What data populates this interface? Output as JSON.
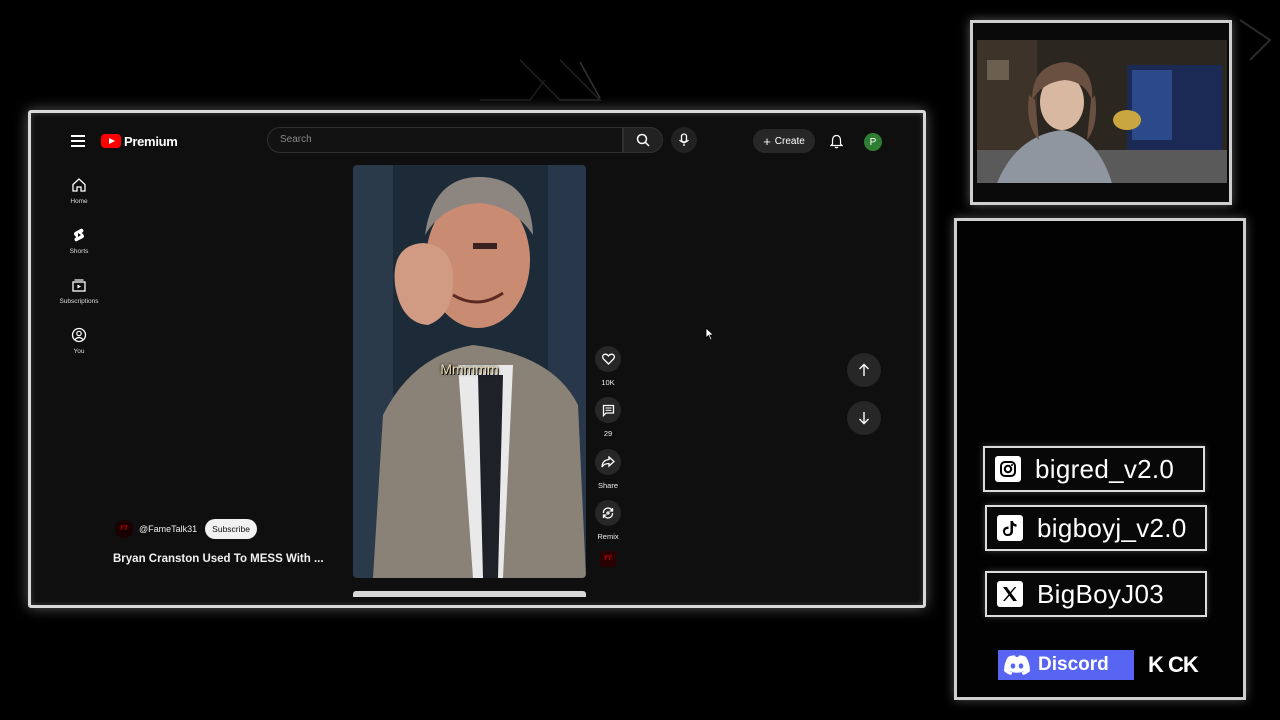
{
  "youtube": {
    "logo_text": "Premium",
    "search_placeholder": "Search",
    "create_label": "Create",
    "avatar_initial": "P",
    "sidebar": [
      {
        "label": "Home",
        "icon": "home-icon"
      },
      {
        "label": "Shorts",
        "icon": "shorts-icon"
      },
      {
        "label": "Subscriptions",
        "icon": "subscriptions-icon"
      },
      {
        "label": "You",
        "icon": "you-icon"
      }
    ],
    "short": {
      "caption": "Mmmmm",
      "channel_handle": "@FameTalk31",
      "channel_logo_text": "FT",
      "subscribe_label": "Subscribe",
      "title": "Bryan Cranston Used To MESS With ..."
    },
    "actions": {
      "like_count": "10K",
      "comment_count": "29",
      "share_label": "Share",
      "remix_label": "Remix"
    }
  },
  "socials": {
    "instagram": "bigred_v2.0",
    "tiktok": "bigboyj_v2.0",
    "x": "BigBoyJ03",
    "discord": "Discord",
    "kick": "K CK"
  },
  "colors": {
    "youtube_red": "#ff0000",
    "discord_blurple": "#5865f2",
    "frame_glow": "#d9d9d9"
  }
}
